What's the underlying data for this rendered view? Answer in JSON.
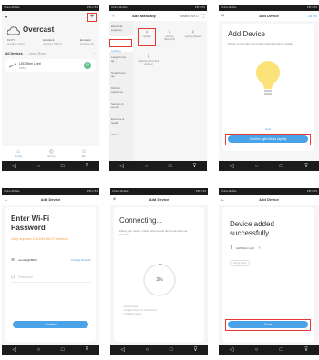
{
  "status": {
    "left": "China Mobile",
    "right": "PM 1:53"
  },
  "nav": [
    "◁",
    "○",
    "□",
    "⊽"
  ],
  "home": {
    "home_name": " ",
    "weather": "Overcast",
    "stats": [
      {
        "value": "19.5°C",
        "label": "Outdoor Temp"
      },
      {
        "value": "Excellent",
        "label": "Outdoor PM2.5"
      },
      {
        "value": "Excellent",
        "label": "Outdoor Air"
      }
    ],
    "tabs": [
      "All Devices",
      "Living Room",
      "···"
    ],
    "device": {
      "name": "LED Strip Light",
      "sub": "Offline"
    },
    "bottom_tabs": [
      "Home",
      "Scene",
      "Me"
    ]
  },
  "addmanual": {
    "title": "Add Manually",
    "search": "Search for D",
    "categories": [
      "Electrical engineer...",
      "Lighting",
      "Large home ap...",
      "Small home ap...",
      "Kitchen Appliance",
      "Security & sensor",
      "Exercise & health",
      "Others"
    ],
    "devices": [
      "Lighting",
      "Lighting (Bluetooth)",
      "Lighting (Zigbee)",
      "Lightstrip (other BLE devices)"
    ]
  },
  "adddevice1": {
    "header": "Add Device",
    "right": "All Mo",
    "title": "Add Device",
    "desc": "Power on the light and confirm that light blinks rapidly",
    "help": "Help",
    "button": "Confirm light blinks rapidly"
  },
  "wifi": {
    "header": "Add Device",
    "title": "Enter Wi-Fi Password",
    "warn": "Only support 2.4GHz Wi-Fi network",
    "ssid": "wondrlight5868",
    "change": "Change Network",
    "password_placeholder": "Password",
    "button": "Confirm"
  },
  "connecting": {
    "header": "Add Device",
    "title": "Connecting...",
    "desc": "Place your router, mobile phone, and device as close as possible",
    "progress": "3%",
    "steps": [
      "Device found",
      "Register device on Smart Cloud",
      "Initializing device"
    ]
  },
  "success": {
    "header": "Add Device",
    "title": "Device added successfully",
    "device": "LED Strip Light",
    "room_chip": "Dining Room",
    "button": "Done"
  },
  "colors": {
    "accent": "#4aa3e8",
    "highlight": "#e53935",
    "bulb": "#fbe37a",
    "green": "#5ec18a"
  }
}
